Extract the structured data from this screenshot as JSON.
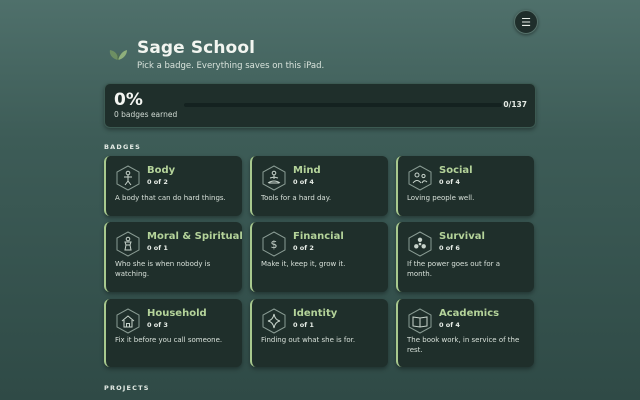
{
  "header": {
    "title": "Sage School",
    "subtitle": "Pick a badge. Everything saves on this iPad.",
    "menu_glyph": "☰"
  },
  "progress": {
    "percent_label": "0%",
    "earned_label": "0 badges earned",
    "total_label": "0/137",
    "fraction": 0
  },
  "sections": {
    "badges": "BADGES",
    "projects": "PROJECTS"
  },
  "colors": {
    "accent": "#a8c98e",
    "card": "#1f2f2b"
  },
  "badges": [
    {
      "name": "Body",
      "count": "0 of 2",
      "desc": "A body that can do hard things.",
      "icon": "body-icon"
    },
    {
      "name": "Mind",
      "count": "0 of 4",
      "desc": "Tools for a hard day.",
      "icon": "meditation-icon"
    },
    {
      "name": "Social",
      "count": "0 of 4",
      "desc": "Loving people well.",
      "icon": "people-icon"
    },
    {
      "name": "Moral & Spiritual",
      "count": "0 of 1",
      "desc": "Who she is when nobody is watching.",
      "icon": "spiritual-icon"
    },
    {
      "name": "Financial",
      "count": "0 of 2",
      "desc": "Make it, keep it, grow it.",
      "icon": "dollar-icon"
    },
    {
      "name": "Survival",
      "count": "0 of 6",
      "desc": "If the power goes out for a month.",
      "icon": "radiation-icon"
    },
    {
      "name": "Household",
      "count": "0 of 3",
      "desc": "Fix it before you call someone.",
      "icon": "house-icon"
    },
    {
      "name": "Identity",
      "count": "0 of 1",
      "desc": "Finding out what she is for.",
      "icon": "sparkle-icon"
    },
    {
      "name": "Academics",
      "count": "0 of 4",
      "desc": "The book work, in service of the rest.",
      "icon": "book-icon"
    }
  ]
}
